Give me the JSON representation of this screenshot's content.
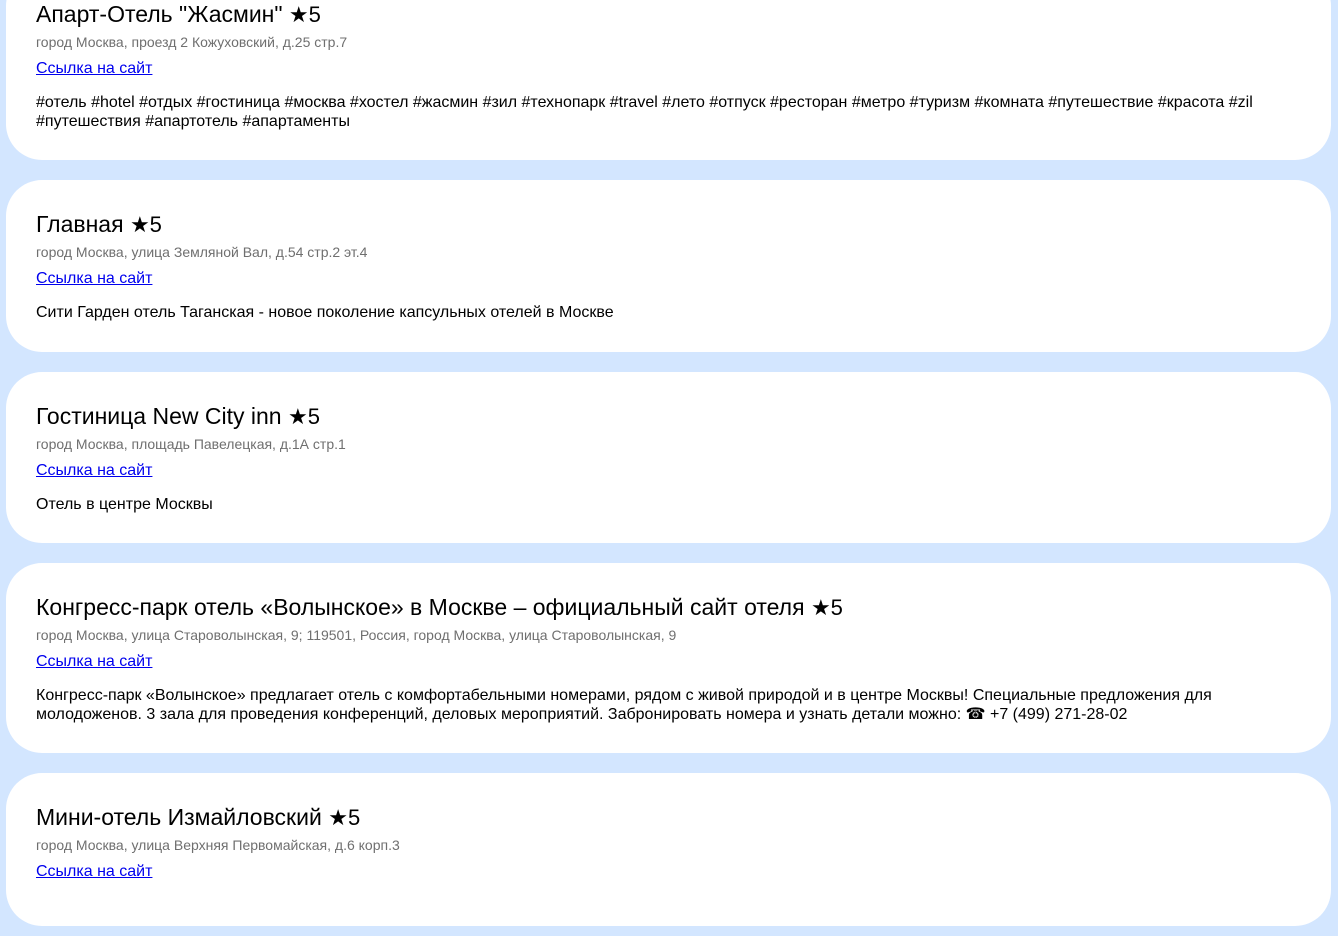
{
  "hotels": [
    {
      "title": "Апарт-Отель \"Жасмин\"",
      "rating": "★5",
      "address": "город Москва, проезд 2 Кожуховский, д.25 стр.7",
      "link_label": "Ссылка на сайт",
      "description": "#отель #hotel #отдых #гостиница #москва #хостел #жасмин #зил #технопарк #travel #лето #отпуск #ресторан #метро #туризм #комната #путешествие #красота #zil #путешествия #апартотель #апартаменты"
    },
    {
      "title": "Главная",
      "rating": "★5",
      "address": "город Москва, улица Земляной Вал, д.54 стр.2 эт.4",
      "link_label": "Ссылка на сайт",
      "description": "Сити Гарден отель Таганская - новое поколение капсульных отелей в Москве"
    },
    {
      "title": "Гостиница New City inn",
      "rating": "★5",
      "address": "город Москва, площадь Павелецкая, д.1А стр.1",
      "link_label": "Ссылка на сайт",
      "description": "Отель в центре Москвы"
    },
    {
      "title": "Конгресс-парк отель «Волынское» в Москве – официальный сайт отеля",
      "rating": "★5",
      "address": "город Москва, улица Староволынская, 9; 119501, Россия, город Москва, улица Староволынская, 9",
      "link_label": "Ссылка на сайт",
      "description": "Конгресс-парк «Волынское» предлагает отель с комфортабельными номерами, рядом с живой природой и в центре Москвы! Специальные предложения для молодоженов. 3 зала для проведения конференций, деловых мероприятий. Забронировать номера и узнать детали можно: ☎ +7 (499) 271-28-02"
    },
    {
      "title": "Мини-отель Измайловский",
      "rating": "★5",
      "address": "город Москва, улица Верхняя Первомайская, д.6 корп.3",
      "link_label": "Ссылка на сайт",
      "description": ""
    }
  ],
  "colors": {
    "page_background": "#d3e6ff",
    "card_background": "#ffffff",
    "address_text": "#6f6f6f",
    "link": "#0000ee"
  }
}
